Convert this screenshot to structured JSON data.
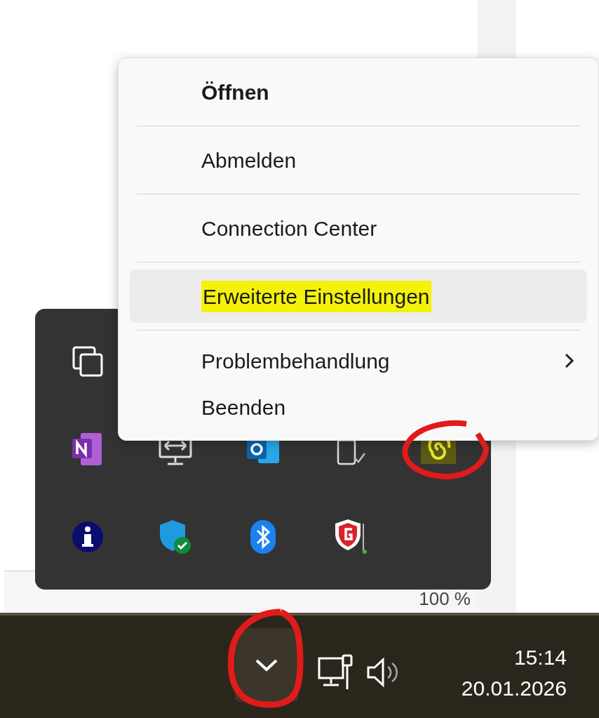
{
  "context_menu": {
    "items": [
      {
        "label": "Öffnen",
        "kind": "default",
        "selected": false,
        "submenu": false,
        "separator_after": true
      },
      {
        "label": "Abmelden",
        "kind": "normal",
        "selected": false,
        "submenu": false,
        "separator_after": true
      },
      {
        "label": "Connection Center",
        "kind": "normal",
        "selected": false,
        "submenu": false,
        "separator_after": true
      },
      {
        "label": "Erweiterte Einstellungen",
        "kind": "normal",
        "selected": true,
        "submenu": false,
        "separator_after": true
      },
      {
        "label": "Problembehandlung",
        "kind": "normal",
        "selected": false,
        "submenu": true,
        "separator_after": false
      },
      {
        "label": "Beenden",
        "kind": "normal",
        "selected": false,
        "submenu": false,
        "separator_after": false
      }
    ]
  },
  "window": {
    "zoom": "100 %"
  },
  "taskbar": {
    "overflow_open": true,
    "clock": {
      "time": "15:14",
      "date": "20.01.2026"
    }
  }
}
